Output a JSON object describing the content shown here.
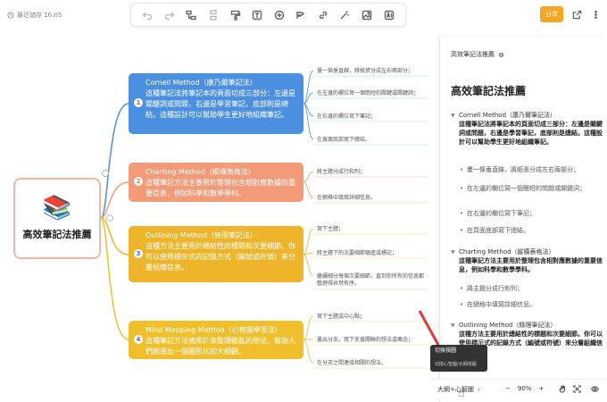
{
  "header": {
    "save_status": "最近儲存 16:05",
    "share_label": "分享"
  },
  "toolbar": {
    "items": [
      "undo-icon",
      "redo-icon",
      "child-node-icon",
      "sibling-node-icon",
      "format-painter-icon",
      "text-style-icon",
      "insert-icon",
      "relation-icon",
      "link-icon",
      "magic-icon",
      "image-icon",
      "ai-icon"
    ]
  },
  "mindmap": {
    "root": {
      "title": "高效筆記法推薦"
    },
    "branches": [
      {
        "num": "1",
        "title": "Cornell Method（康乃爾筆記法）",
        "desc": "這種筆記法將筆記本的頁面切成三部分：左邊是關鍵詞或問題，右邊是學習筆記，底部則是總結。這種設計可以幫助學生更好地組織筆記。",
        "leaves": [
          "畫一條垂直線，將紙張分成左右兩部分；",
          "在左邊的欄位寫一個簡短的關鍵或關鍵詞；",
          "在右邊的欄位寫下筆記；",
          "在頁面底部寫下總結。"
        ]
      },
      {
        "num": "2",
        "title": "Charting Method（縱橫表格法）",
        "desc": "這種筆記方法主要用於整理包含相對應數據的重要信息，例如科學和數學學科。",
        "leaves": [
          "將主題分成行和列；",
          "在網格中填寫詳細信息。"
        ]
      },
      {
        "num": "3",
        "title": "Outlining Method（條理筆記法）",
        "desc": "這種方法主要用於總結性的標題和次要細節。你可以使用標示式的記錄方式（編號或符號）來分層組織信息。",
        "leaves": [
          "寫下主題；",
          "將主題下的次要細節縮進或標記；",
          "繼續細分每個次要細節，直到你所有的信息都整理得井然有序。"
        ]
      },
      {
        "num": "4",
        "title": "Mind Mapping Method（心智圖學習法）",
        "desc": "這種筆記方法適用於來整理難亂的想法，幫助人們創造出一個圖形化的大綱觀。",
        "leaves": [
          "寫下主題或中心點；",
          "畫出分支，寫下支援關聯的想法或概念；",
          "在分支之間連接相關的想法。"
        ]
      }
    ]
  },
  "outline_panel": {
    "header": "高效筆記法推薦",
    "title": "高效筆記法推薦",
    "items": [
      {
        "title": "Cornell Method（康乃爾筆記法）",
        "desc": "這種筆記法將筆記本的頁面切成三部分：左邊是關鍵詞或問題，右邊是學習筆記，底部則是總結。這種設計可以幫助學生更好地組織筆記。",
        "subs": [
          "畫一條垂直線，將紙張分成左右兩部分；",
          "在左邊的欄位寫一個簡短的問題或關鍵詞；",
          "在右邊的欄位寫下筆記；",
          "在頁面底部寫下總結。"
        ]
      },
      {
        "title": "Charting Method（縱橫表格法）",
        "desc": "這種筆記方法主要用於整理包含相對應數據的重要信息，例如科學和數學學科。",
        "subs": [
          "將主題分成行和列；",
          "在網格中填寫詳細信息。"
        ]
      },
      {
        "title": "Outlining Method（條理筆記法）",
        "desc": "這種方法主要用於總結性的標題和次要細節。你可以使用標示式的記錄方式（編號或符號）來分層組織信息。",
        "subs": []
      }
    ]
  },
  "tooltip": {
    "title": "切換視圖",
    "desc": "切換心智圖/大綱視圖"
  },
  "bottom_bar": {
    "mode_label": "大綱+心智圖",
    "zoom_out": "−",
    "zoom_value": "90%",
    "zoom_in": "+"
  },
  "colors": {
    "branch1": "#4a8fe0",
    "branch2": "#f39a78",
    "branch3": "#efb52a",
    "branch4": "#f0c02c",
    "accent": "#f5a623"
  }
}
